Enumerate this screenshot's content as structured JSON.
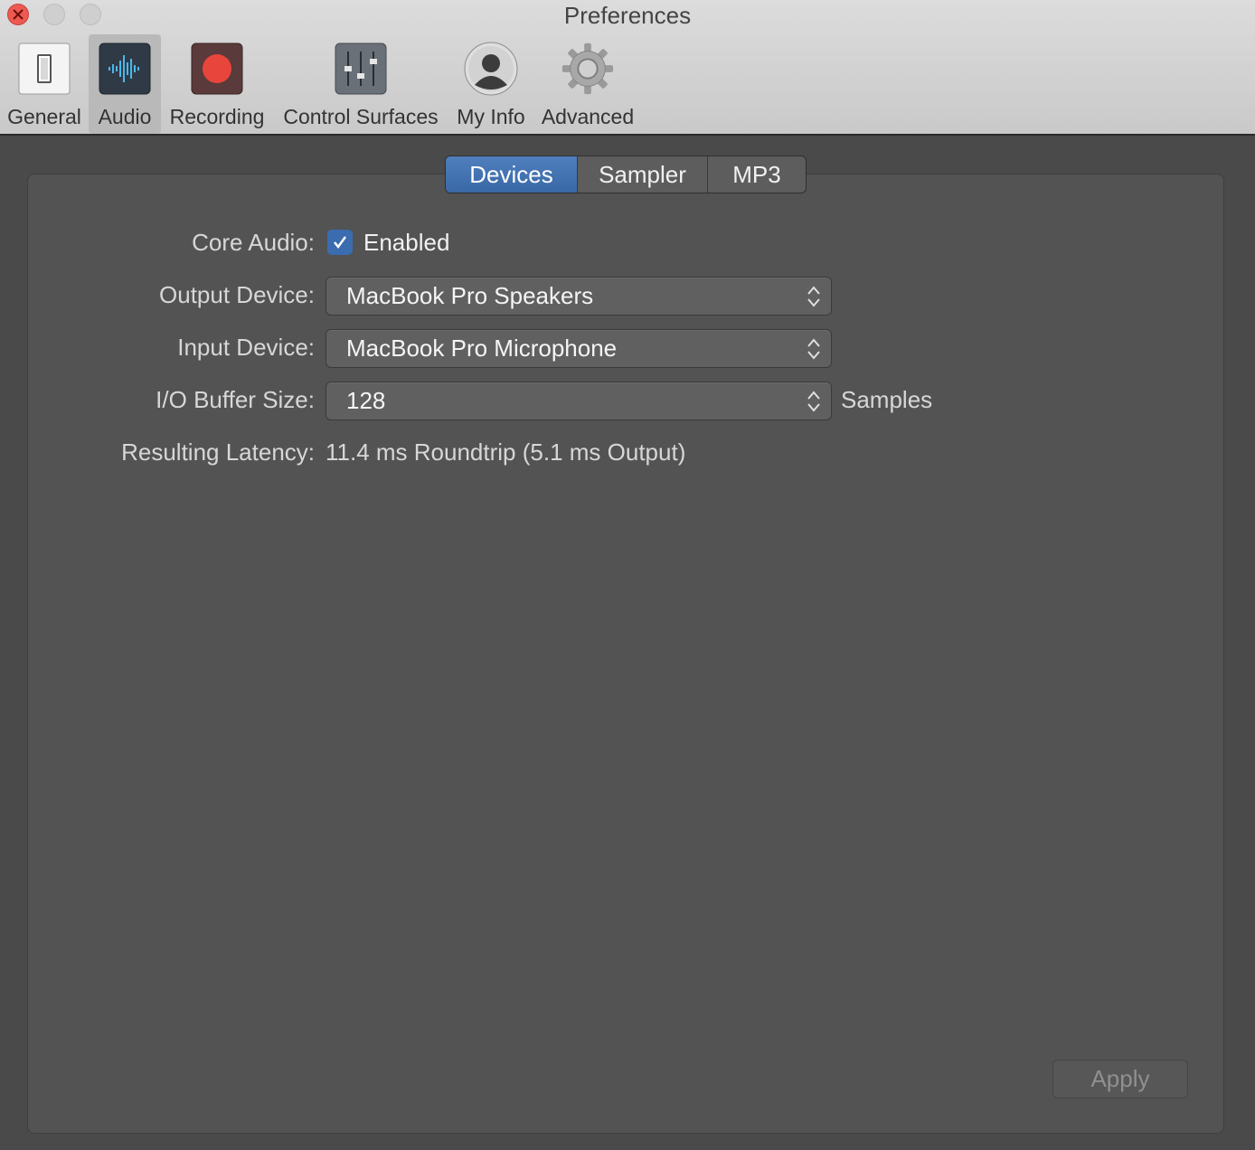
{
  "window": {
    "title": "Preferences"
  },
  "toolbar": {
    "items": [
      {
        "label": "General",
        "icon": "switch-icon",
        "selected": false
      },
      {
        "label": "Audio",
        "icon": "waveform-icon",
        "selected": true
      },
      {
        "label": "Recording",
        "icon": "record-icon",
        "selected": false
      },
      {
        "label": "Control Surfaces",
        "icon": "fader-icon",
        "selected": false
      },
      {
        "label": "My Info",
        "icon": "user-icon",
        "selected": false
      },
      {
        "label": "Advanced",
        "icon": "gear-icon",
        "selected": false
      }
    ]
  },
  "tabs": [
    {
      "label": "Devices",
      "active": true
    },
    {
      "label": "Sampler",
      "active": false
    },
    {
      "label": "MP3",
      "active": false
    }
  ],
  "form": {
    "core_audio_label": "Core Audio:",
    "core_audio_checkbox_label": "Enabled",
    "core_audio_checked": true,
    "output_device_label": "Output Device:",
    "output_device_value": "MacBook Pro Speakers",
    "input_device_label": "Input Device:",
    "input_device_value": "MacBook Pro Microphone",
    "buffer_size_label": "I/O Buffer Size:",
    "buffer_size_value": "128",
    "buffer_size_unit": "Samples",
    "latency_label": "Resulting Latency:",
    "latency_value": "11.4 ms Roundtrip (5.1 ms Output)"
  },
  "apply_label": "Apply",
  "colors": {
    "accent": "#3b6cb0",
    "record": "#e8453c",
    "close": "#ee5a52"
  }
}
